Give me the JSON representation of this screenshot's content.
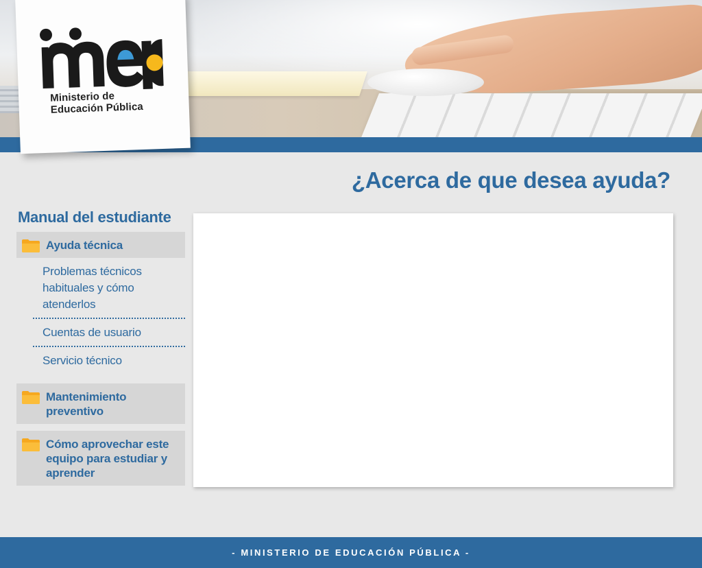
{
  "logo": {
    "wordmark": "mep",
    "subtitle_line1": "Ministerio de",
    "subtitle_line2": "Educación Pública"
  },
  "page": {
    "heading": "¿Acerca de que desea ayuda?"
  },
  "sidebar": {
    "title": "Manual del estudiante",
    "sections": [
      {
        "label": "Ayuda técnica",
        "icon": "folder-icon",
        "items": [
          "Problemas técnicos habituales y cómo atenderlos",
          "Cuentas de usuario",
          "Servicio técnico"
        ]
      },
      {
        "label": "Mantenimiento preventivo",
        "icon": "folder-icon"
      },
      {
        "label": "Cómo aprovechar este equipo para estudiar y aprender",
        "icon": "folder-icon"
      }
    ]
  },
  "footer": {
    "text": "- MINISTERIO DE EDUCACIÓN PÚBLICA -"
  },
  "colors": {
    "brand_blue": "#2e6a9f",
    "folder_orange": "#f6a81f",
    "logo_blue": "#3d9ad6",
    "logo_yellow": "#f6b81c",
    "background": "#e8e8e8"
  }
}
